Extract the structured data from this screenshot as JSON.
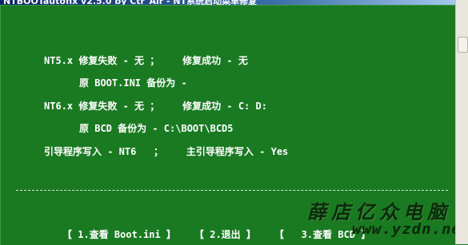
{
  "window": {
    "title": "NTBOOTautofix v2.5.0 by Ctr_Air - NT系统启动菜单修复"
  },
  "report": {
    "nt5": "NT5.x 修复失败 - 无 ；    修复成功 - 无",
    "nt5_backup": "原 BOOT.INI 备份为 -",
    "nt6": "NT6.x 修复失败 - 无 ；    修复成功 - C: D:",
    "nt6_backup": "原 BCD 备份为 - C:\\BOOT\\BCD5",
    "boot_write": "引导程序写入 - NT6   ；    主引导程序写入 - Yes"
  },
  "menu": {
    "item1": "【 1.查看 Boot.ini 】",
    "item2": "【 2.退出 】",
    "item3": "【   3.查看 BCD 】"
  },
  "watermark": {
    "name": "薛店亿众电脑",
    "url": "www.yzdn.net"
  },
  "colors": {
    "background": "#1a7a22",
    "text": "#ffffff",
    "watermark": "#0b2a0b"
  }
}
